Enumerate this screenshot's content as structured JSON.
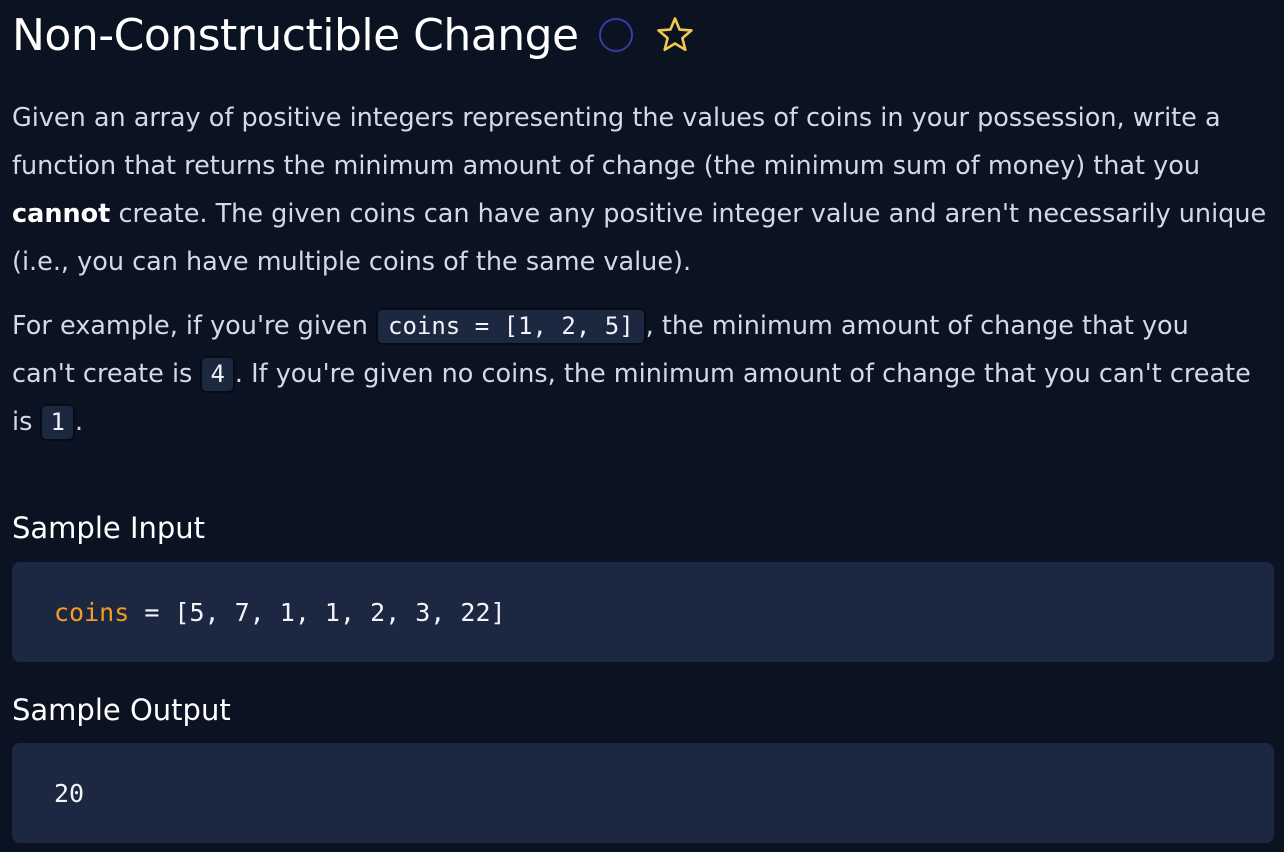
{
  "problem": {
    "title": "Non-Constructible Change",
    "description": {
      "line1": "Given an array of positive integers representing the values of coins in your possession, write a",
      "line2": "function that returns the minimum amount of change (the minimum sum of money) that you",
      "line3_bold": "cannot",
      "line3_rest": " create. The given coins can have any positive integer value and aren't necessarily unique",
      "line4": "(i.e., you can have multiple coins of the same value)."
    },
    "example": {
      "part1": "For example, if you're given ",
      "code1": "coins = [1, 2, 5]",
      "part2": ", the minimum amount of change that you",
      "part3": "can't create is ",
      "code2": "4",
      "part4": ". If you're given no coins, the minimum amount of change that you can't create",
      "part5": "is ",
      "code3": "1",
      "part6": "."
    }
  },
  "sample_input": {
    "heading": "Sample Input",
    "variable": "coins",
    "rest": " = [5, 7, 1, 1, 2, 3, 22]"
  },
  "sample_output": {
    "heading": "Sample Output",
    "value": "20"
  },
  "colors": {
    "background": "#0b1322",
    "code_block_bg": "#1c2742",
    "variable_token": "#f39c1f",
    "star": "#f2c94c",
    "status_circle": "#3a3aa8"
  },
  "icons": [
    "status-circle-icon",
    "star-icon"
  ]
}
